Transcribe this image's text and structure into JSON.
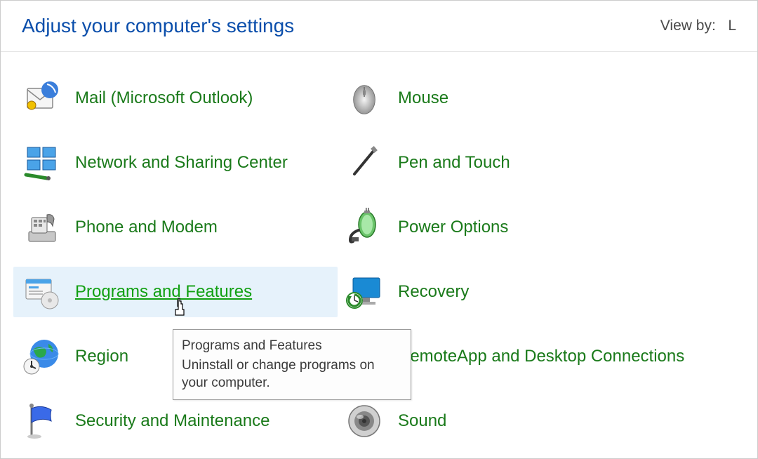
{
  "header": {
    "title": "Adjust your computer's settings",
    "view_by_label": "View by:",
    "view_by_value": "L"
  },
  "items": {
    "mail": {
      "label": "Mail (Microsoft Outlook)"
    },
    "mouse": {
      "label": "Mouse"
    },
    "network": {
      "label": "Network and Sharing Center"
    },
    "pen": {
      "label": "Pen and Touch"
    },
    "phone": {
      "label": "Phone and Modem"
    },
    "power": {
      "label": "Power Options"
    },
    "programs": {
      "label": "Programs and Features"
    },
    "recovery": {
      "label": "Recovery"
    },
    "region": {
      "label": "Region"
    },
    "remoteapp": {
      "label": "RemoteApp and Desktop Connections"
    },
    "security": {
      "label": "Security and Maintenance"
    },
    "sound": {
      "label": "Sound"
    }
  },
  "tooltip": {
    "title": "Programs and Features",
    "body": "Uninstall or change programs on your computer."
  }
}
